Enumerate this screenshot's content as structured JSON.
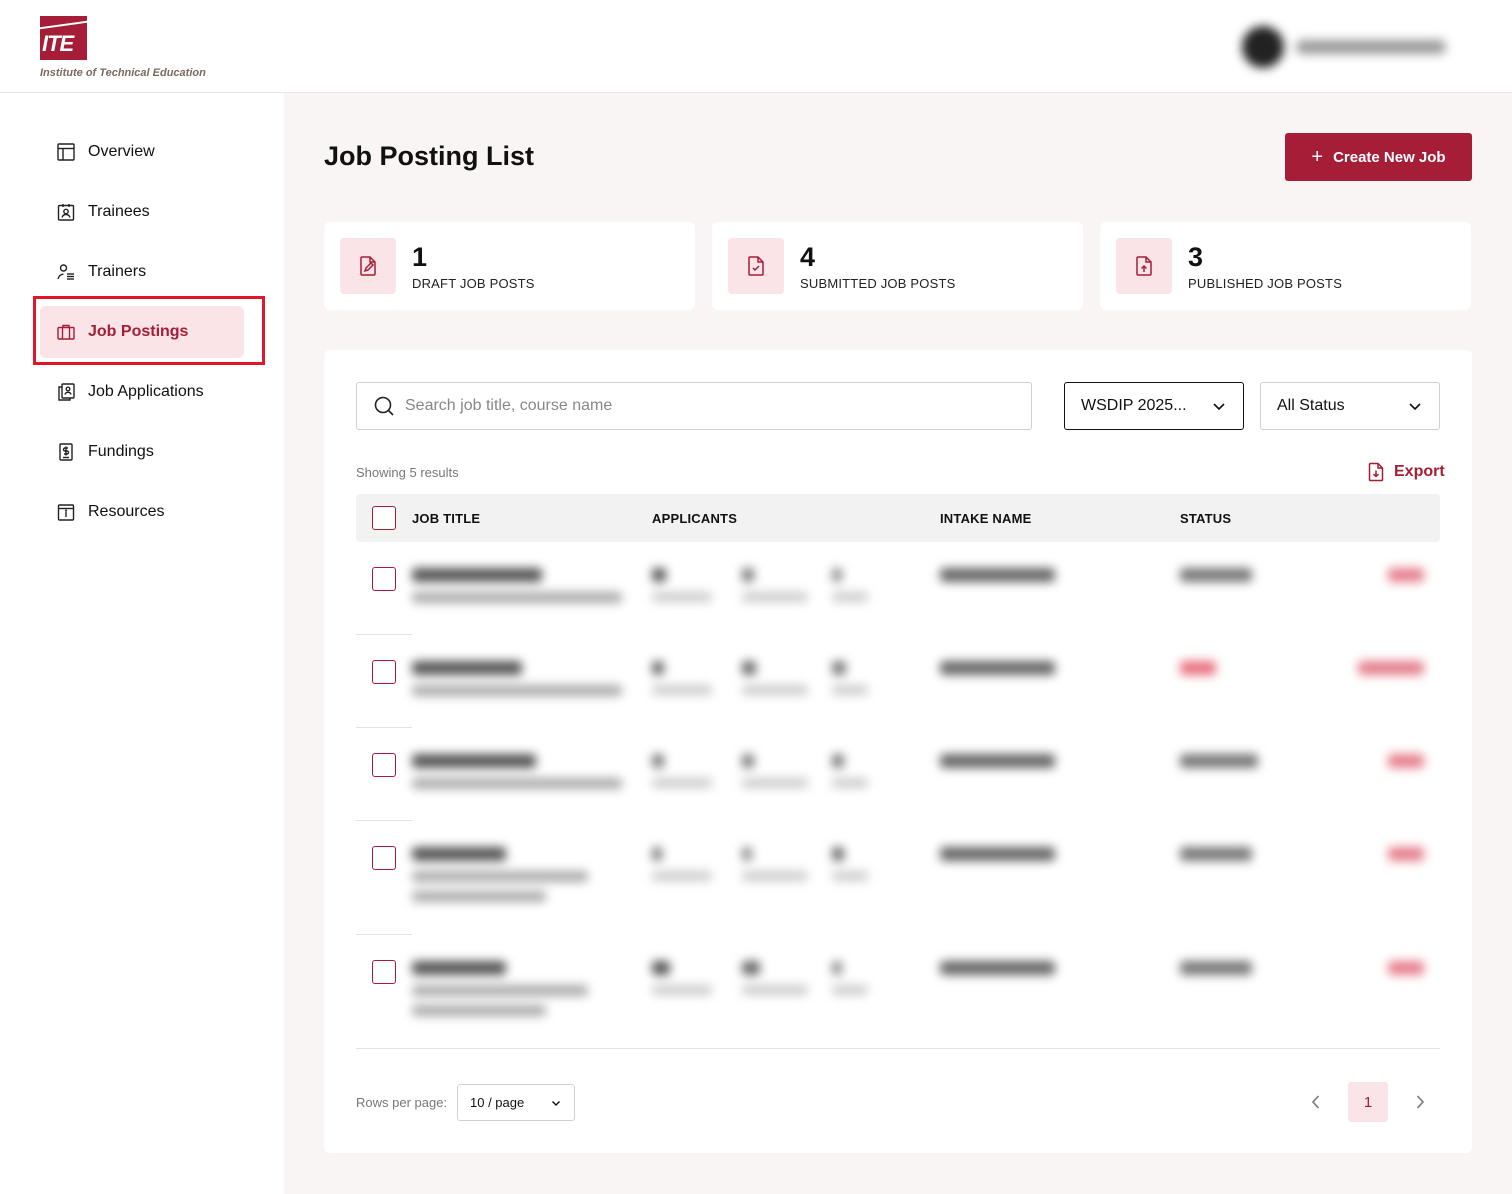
{
  "brand": {
    "logo_text": "ITE",
    "org_name": "Institute of Technical Education",
    "accent_color": "#a51d36"
  },
  "sidebar": {
    "items": [
      {
        "label": "Overview",
        "icon": "layout-icon"
      },
      {
        "label": "Trainees",
        "icon": "id-badge-icon"
      },
      {
        "label": "Trainers",
        "icon": "user-list-icon"
      },
      {
        "label": "Job Postings",
        "icon": "briefcase-icon",
        "active": true
      },
      {
        "label": "Job Applications",
        "icon": "documents-icon"
      },
      {
        "label": "Fundings",
        "icon": "money-document-icon"
      },
      {
        "label": "Resources",
        "icon": "info-calendar-icon"
      }
    ]
  },
  "main": {
    "title": "Job Posting List",
    "create_button": "Create New Job",
    "stats": [
      {
        "value": "1",
        "label": "DRAFT JOB POSTS",
        "icon": "edit-document-icon"
      },
      {
        "value": "4",
        "label": "SUBMITTED JOB POSTS",
        "icon": "check-document-icon"
      },
      {
        "value": "3",
        "label": "PUBLISHED JOB POSTS",
        "icon": "upload-document-icon"
      }
    ],
    "search": {
      "placeholder": "Search job title, course name"
    },
    "filters": {
      "intake_selected": "WSDIP 2025...",
      "status_selected": "All Status"
    },
    "showing_text": "Showing 5 results",
    "export_label": "Export",
    "table": {
      "columns": [
        "JOB TITLE",
        "APPLICANTS",
        "INTAKE NAME",
        "STATUS"
      ]
    },
    "pagination": {
      "rows_per_page_label": "Rows per page:",
      "rows_per_page_value": "10 / page",
      "current_page": "1"
    }
  }
}
